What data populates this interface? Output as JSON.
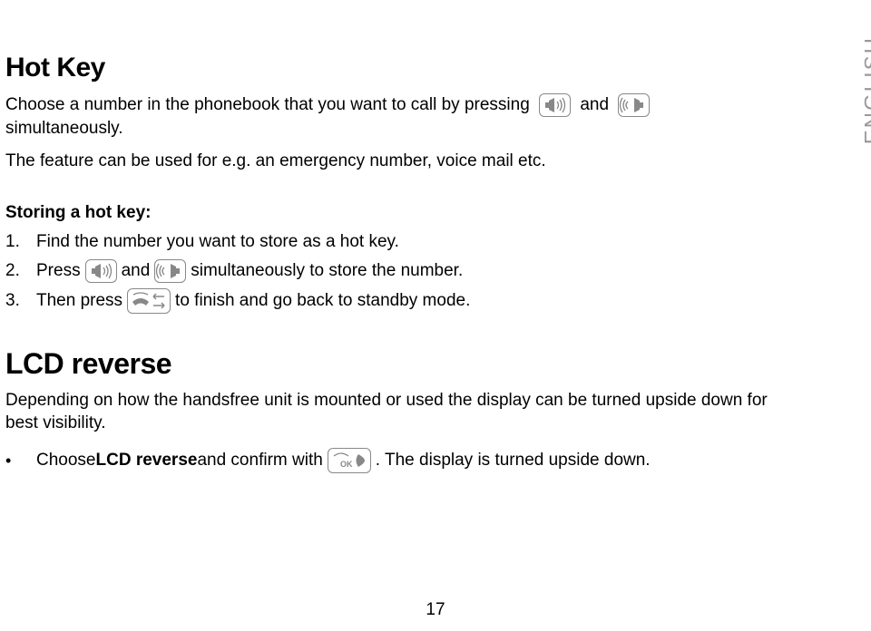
{
  "side_label": "ENGLISH",
  "hotkey": {
    "heading": "Hot Key",
    "p1a": "Choose a number in the phonebook that you want to call by pressing ",
    "p1b": " and ",
    "p1c": " simultaneously.",
    "p2": "The feature can be used for e.g. an emergency number, voice mail etc.",
    "storing_head": "Storing a hot key:",
    "s1_num": "1.",
    "s1_txt": "Find the number you want to store as a hot key.",
    "s2_num": "2.",
    "s2_a": "Press ",
    "s2_b": " and ",
    "s2_c": " simultaneously to store the number.",
    "s3_num": "3.",
    "s3_a": "Then press ",
    "s3_b": " to finish and go back to standby mode."
  },
  "lcd": {
    "heading": "LCD reverse",
    "p1": "Depending on how the handsfree unit is mounted or used the display can be turned upside down for best visibility.",
    "bullet_a": "Choose ",
    "bullet_b_strong": "LCD reverse",
    "bullet_c": " and confirm with ",
    "bullet_d": ". The display is turned upside down."
  },
  "page_number": "17"
}
